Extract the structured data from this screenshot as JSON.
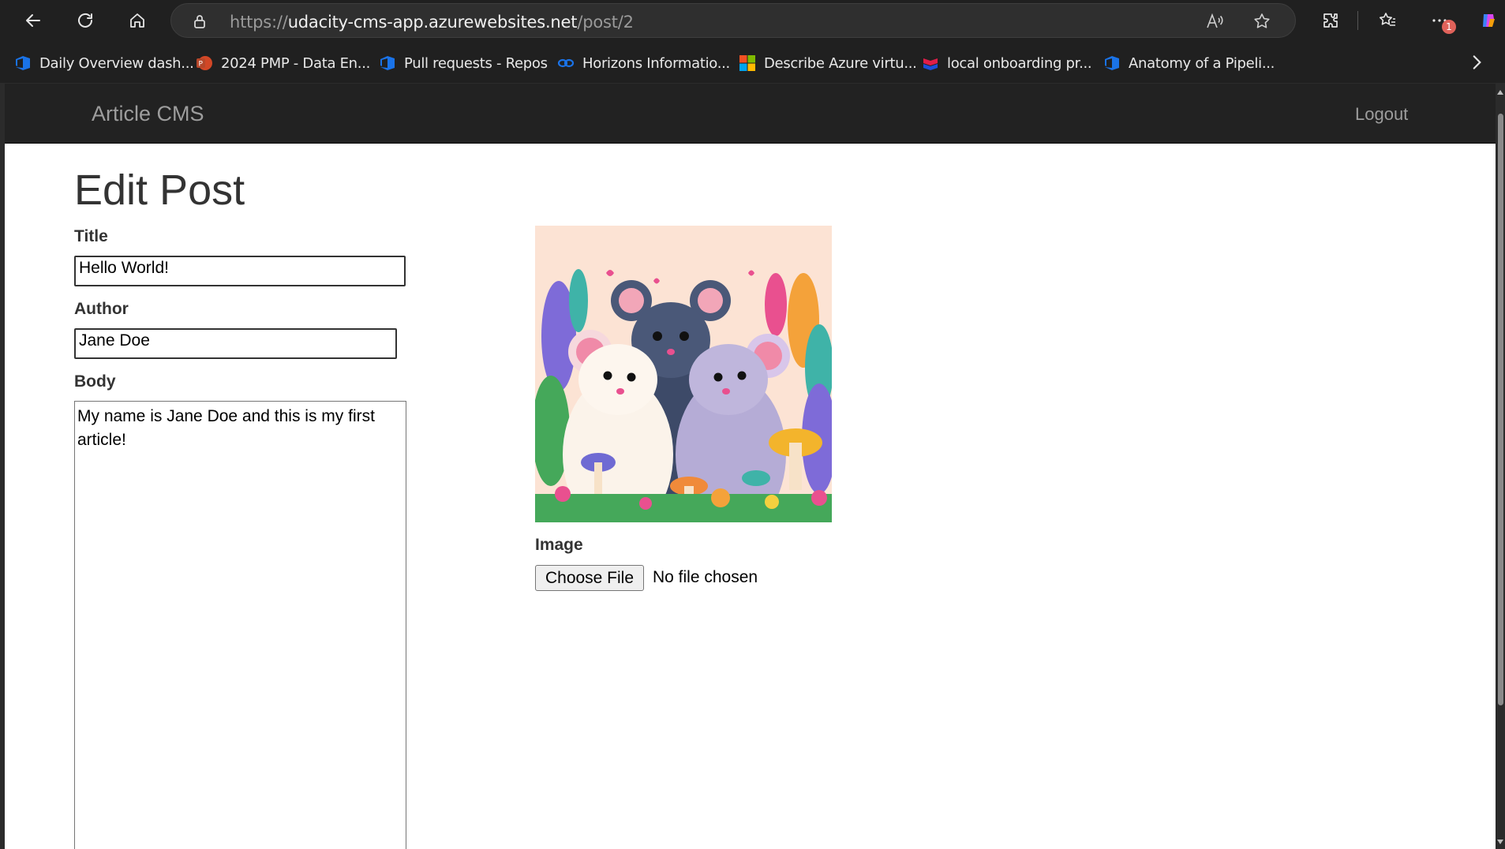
{
  "browser": {
    "url_scheme": "https://",
    "url_host": "udacity-cms-app.azurewebsites.net",
    "url_path": "/post/2",
    "notification_count": "1",
    "bookmarks": [
      {
        "label": "Daily Overview dash...",
        "icon": "azure-devops-icon"
      },
      {
        "label": "2024 PMP - Data En...",
        "icon": "powerpoint-icon"
      },
      {
        "label": "Pull requests - Repos",
        "icon": "azure-devops-icon"
      },
      {
        "label": "Horizons Informatio...",
        "icon": "link-icon"
      },
      {
        "label": "Describe Azure virtu...",
        "icon": "microsoft-icon"
      },
      {
        "label": "local onboarding pr...",
        "icon": "brand-icon"
      },
      {
        "label": "Anatomy of a Pipeli...",
        "icon": "azure-devops-icon"
      }
    ]
  },
  "app": {
    "brand": "Article CMS",
    "logout": "Logout"
  },
  "form": {
    "heading": "Edit Post",
    "title_label": "Title",
    "title_value": "Hello World!",
    "author_label": "Author",
    "author_value": "Jane Doe",
    "body_label": "Body",
    "body_value": "My name is Jane Doe and this is my first article!",
    "image_label": "Image",
    "choose_file": "Choose File",
    "file_status": "No file chosen"
  },
  "colors": {
    "navbar_bg": "#222222",
    "navbar_text": "#9d9d9d",
    "chrome_bg": "#202020"
  }
}
